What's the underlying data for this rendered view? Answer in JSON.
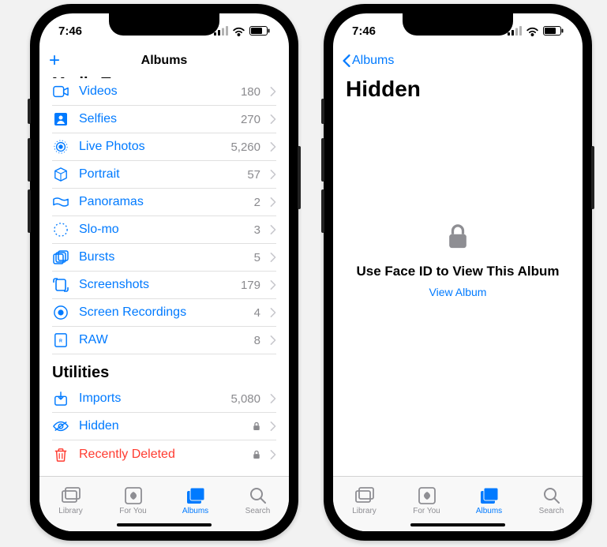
{
  "status": {
    "time": "7:46"
  },
  "screen1": {
    "nav_title": "Albums",
    "sections": [
      {
        "header": "Media Types",
        "cut": true,
        "items": [
          {
            "icon": "videos",
            "label": "Videos",
            "count": "180"
          },
          {
            "icon": "selfies",
            "label": "Selfies",
            "count": "270"
          },
          {
            "icon": "livephotos",
            "label": "Live Photos",
            "count": "5,260"
          },
          {
            "icon": "portrait",
            "label": "Portrait",
            "count": "57"
          },
          {
            "icon": "panoramas",
            "label": "Panoramas",
            "count": "2"
          },
          {
            "icon": "slomo",
            "label": "Slo-mo",
            "count": "3"
          },
          {
            "icon": "bursts",
            "label": "Bursts",
            "count": "5"
          },
          {
            "icon": "screenshots",
            "label": "Screenshots",
            "count": "179"
          },
          {
            "icon": "screenrec",
            "label": "Screen Recordings",
            "count": "4"
          },
          {
            "icon": "raw",
            "label": "RAW",
            "count": "8"
          }
        ]
      },
      {
        "header": "Utilities",
        "items": [
          {
            "icon": "imports",
            "label": "Imports",
            "count": "5,080"
          },
          {
            "icon": "hidden",
            "label": "Hidden",
            "locked": true
          },
          {
            "icon": "trash",
            "label": "Recently Deleted",
            "locked": true,
            "red": true
          }
        ]
      }
    ]
  },
  "screen2": {
    "back_label": "Albums",
    "page_title": "Hidden",
    "empty_message": "Use Face ID to View This Album",
    "empty_action": "View Album"
  },
  "tabs": [
    {
      "id": "library",
      "label": "Library"
    },
    {
      "id": "foryou",
      "label": "For You"
    },
    {
      "id": "albums",
      "label": "Albums",
      "active": true
    },
    {
      "id": "search",
      "label": "Search"
    }
  ]
}
